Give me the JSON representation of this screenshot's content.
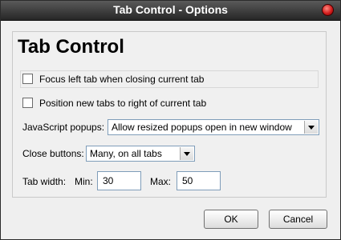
{
  "window": {
    "title": "Tab Control - Options"
  },
  "panel": {
    "heading": "Tab Control",
    "focus_left_label": "Focus left tab when closing current tab",
    "position_right_label": "Position new tabs to right of current tab",
    "js_popups_label": "JavaScript popups:",
    "js_popups_value": "Allow resized popups open in new window",
    "close_buttons_label": "Close buttons:",
    "close_buttons_value": "Many, on all tabs",
    "tab_width_label": "Tab width:",
    "min_label": "Min:",
    "min_value": "30",
    "max_label": "Max:",
    "max_value": "50"
  },
  "buttons": {
    "ok": "OK",
    "cancel": "Cancel"
  }
}
